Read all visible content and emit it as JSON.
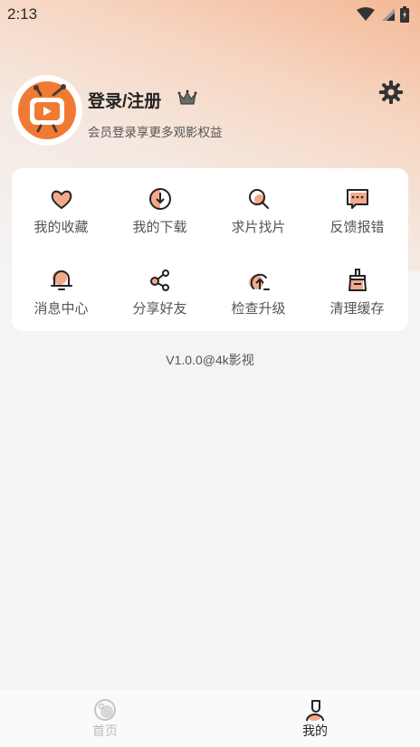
{
  "status_bar": {
    "time": "2:13"
  },
  "profile": {
    "title": "登录/注册",
    "subtitle": "会员登录享更多观影权益"
  },
  "grid": [
    {
      "label": "我的收藏",
      "icon": "heart-icon"
    },
    {
      "label": "我的下载",
      "icon": "download-icon"
    },
    {
      "label": "求片找片",
      "icon": "search-film-icon"
    },
    {
      "label": "反馈报错",
      "icon": "feedback-icon"
    },
    {
      "label": "消息中心",
      "icon": "bell-icon"
    },
    {
      "label": "分享好友",
      "icon": "share-icon"
    },
    {
      "label": "检查升级",
      "icon": "upgrade-icon"
    },
    {
      "label": "清理缓存",
      "icon": "clear-cache-icon"
    }
  ],
  "version": "V1.0.0@4k影视",
  "tabbar": {
    "home": "首页",
    "mine": "我的"
  },
  "colors": {
    "accent": "#f07a33",
    "icon_fill": "#f2a98a",
    "active_tab": "#222222",
    "inactive_tab": "#bbbbbb"
  }
}
